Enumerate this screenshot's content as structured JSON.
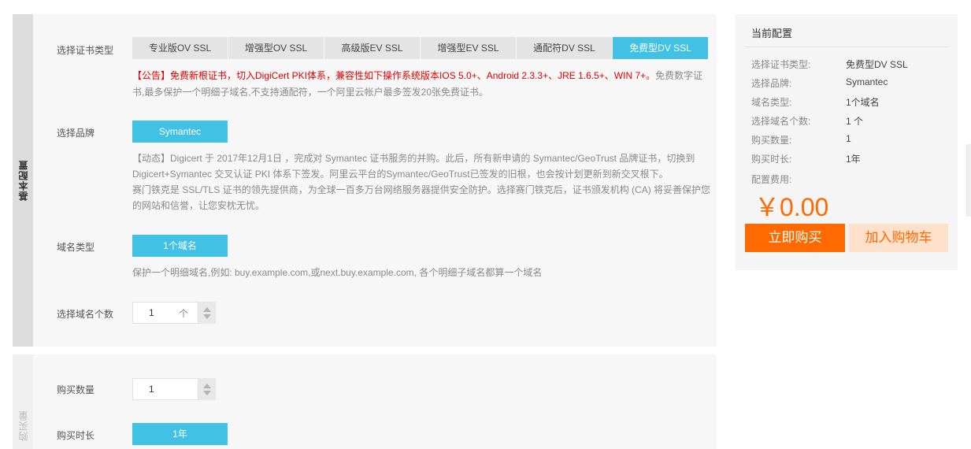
{
  "basic": {
    "tab_label": "基本配置",
    "cert_type_label": "选择证书类型",
    "cert_types": [
      "专业版OV SSL",
      "增强型OV SSL",
      "高级版EV SSL",
      "增强型EV SSL",
      "通配符DV SSL",
      "免费型DV SSL"
    ],
    "notice_red": "【公告】免费新根证书，切入DigiCert PKI体系，兼容性如下操作系统版本IOS 5.0+、Android 2.3.3+、JRE 1.6.5+、WIN 7+。",
    "notice_gray": "免费数字证书,最多保护一个明细子域名,不支持通配符，一个阿里云帐户最多签发20张免费证书。",
    "brand_label": "选择品牌",
    "brand_value": "Symantec",
    "brand_desc_1": "【动态】Digicert 于 2017年12月1日 ，完成对 Symantec 证书服务的并购。此后，所有新申请的 Symantec/GeoTrust 品牌证书，切换到 Digicert+Symantec 交叉认证 PKI 体系下签发。阿里云平台的Symantec/GeoTrust已签发的旧根，也会按计划更新到新交叉根下。",
    "brand_desc_2": "赛门铁克是 SSL/TLS 证书的领先提供商，为全球一百多万台网络服务器提供安全防护。选择赛门铁克后，证书颁发机构 (CA) 将妥善保护您的网站和信誉，让您安枕无忧。",
    "domain_type_label": "域名类型",
    "domain_type_value": "1个域名",
    "domain_desc": "保护一个明细域名,例如: buy.example.com,或next.buy.example.com, 各个明细子域名都算一个域名",
    "domain_count_label": "选择域名个数",
    "domain_count_value": "1",
    "domain_count_unit": "个"
  },
  "purchase": {
    "tab_label": "购买量",
    "qty_label": "购买数量",
    "qty_value": "1",
    "duration_label": "购买时长",
    "duration_value": "1年"
  },
  "summary": {
    "title": "当前配置",
    "rows": [
      {
        "label": "选择证书类型:",
        "value": "免费型DV SSL"
      },
      {
        "label": "选择品牌:",
        "value": "Symantec"
      },
      {
        "label": "域名类型:",
        "value": "1个域名"
      },
      {
        "label": "选择域名个数:",
        "value": "1 个"
      },
      {
        "label": "购买数量:",
        "value": "1"
      },
      {
        "label": "购买时长:",
        "value": "1年"
      }
    ],
    "fee_label": "配置费用:",
    "price": "￥0.00",
    "buy_label": "立即购买",
    "cart_label": "加入购物车"
  },
  "colors": {
    "accent": "#41c1e3",
    "primary_orange": "#ff6a00",
    "notice_red": "#e40000"
  }
}
